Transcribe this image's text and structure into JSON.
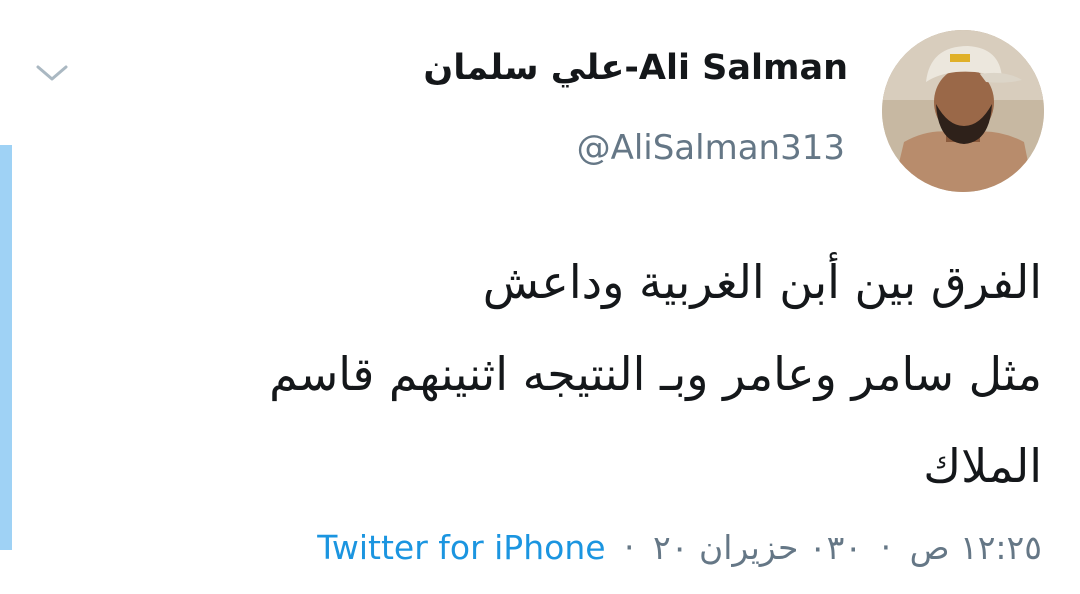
{
  "author": {
    "display_name": "علي سلمان-Ali Salman",
    "handle": "@AliSalman313",
    "avatar": "avatar-photo"
  },
  "tweet": {
    "lines": [
      "الفرق بين أبن الغربية وداعش",
      "مثل سامر وعامر وبـ النتيجه اثنينهم قاسم",
      "الملاك"
    ]
  },
  "meta": {
    "time": "١٢:٢٥ ص",
    "date": "٠٣٠ حزيران ٢٠",
    "separator": "·",
    "source": "Twitter for iPhone"
  },
  "icons": {
    "chevron": "chevron-down-icon"
  },
  "colors": {
    "thread_line": "#9fd2f5",
    "link": "#1b95e0",
    "secondary_text": "#657786"
  }
}
